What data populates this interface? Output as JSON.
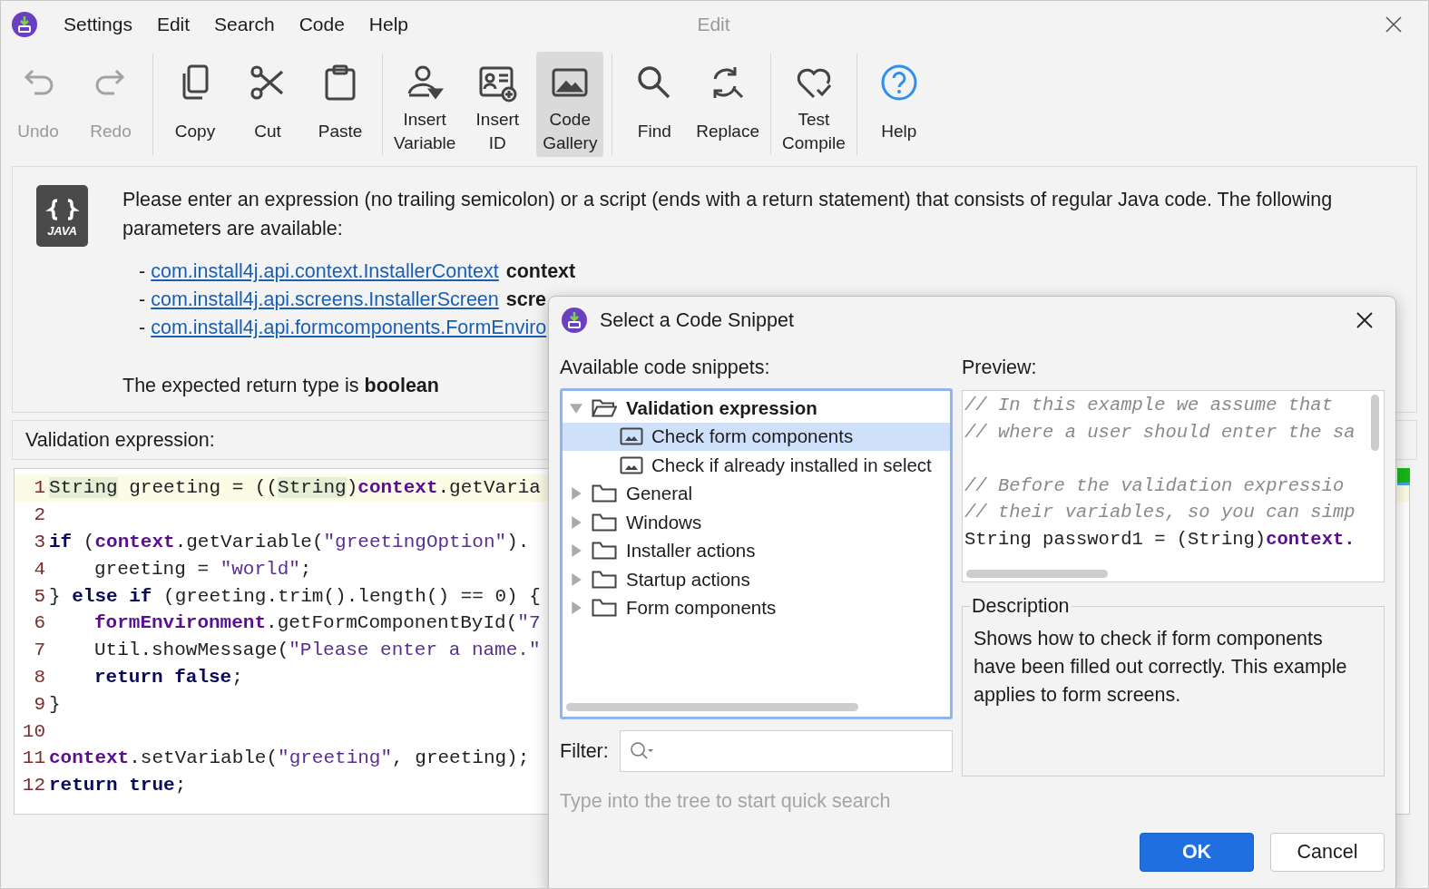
{
  "window": {
    "title": "Edit"
  },
  "menu": [
    "Settings",
    "Edit",
    "Search",
    "Code",
    "Help"
  ],
  "toolbar": [
    [
      {
        "label": "Undo",
        "disabled": true,
        "selected": false
      },
      {
        "label": "Redo",
        "disabled": true,
        "selected": false
      }
    ],
    [
      {
        "label": "Copy",
        "disabled": false,
        "selected": false
      },
      {
        "label": "Cut",
        "disabled": false,
        "selected": false
      },
      {
        "label": "Paste",
        "disabled": false,
        "selected": false
      }
    ],
    [
      {
        "label": "Insert Variable",
        "disabled": false,
        "selected": false
      },
      {
        "label": "Insert ID",
        "disabled": false,
        "selected": false
      },
      {
        "label": "Code Gallery",
        "disabled": false,
        "selected": true
      }
    ],
    [
      {
        "label": "Find",
        "disabled": false,
        "selected": false
      },
      {
        "label": "Replace",
        "disabled": false,
        "selected": false
      }
    ],
    [
      {
        "label": "Test Compile",
        "disabled": false,
        "selected": false
      }
    ],
    [
      {
        "label": "Help",
        "disabled": false,
        "selected": false
      }
    ]
  ],
  "info": {
    "badge": "JAVA",
    "text": "Please enter an expression (no trailing semicolon) or a script (ends with a return statement) that consists of regular Java code. The following parameters are available:",
    "parameters": [
      {
        "dash": "-",
        "type": "com.install4j.api.context.InstallerContext",
        "name": "context"
      },
      {
        "dash": "-",
        "type": "com.install4j.api.screens.InstallerScreen",
        "name": "scre"
      },
      {
        "dash": "-",
        "type": "com.install4j.api.formcomponents.FormEnviro"
      }
    ],
    "return_line": "The expected return type is **boolean**"
  },
  "editor": {
    "label": "Validation expression:",
    "lines": [
      {
        "number": "1",
        "current": true,
        "indented": false,
        "tokens": [
          {
            "kind": "type",
            "text": "String"
          },
          {
            "kind": "plain",
            "text": " greeting = (("
          },
          {
            "kind": "type",
            "text": "String"
          },
          {
            "kind": "plain",
            "text": ")"
          },
          {
            "kind": "field",
            "text": "context"
          },
          {
            "kind": "plain",
            "text": ".getVaria"
          }
        ]
      },
      {
        "number": "2",
        "current": false
      },
      {
        "number": "3",
        "current": false,
        "indented": false,
        "tokens": [
          {
            "kind": "keyword",
            "text": "if"
          },
          {
            "kind": "plain",
            "text": " ("
          },
          {
            "kind": "field",
            "text": "context"
          },
          {
            "kind": "plain",
            "text": ".getVariable("
          },
          {
            "kind": "string",
            "text": "\"greetingOption\""
          },
          {
            "kind": "plain",
            "text": ")."
          }
        ]
      },
      {
        "number": "4",
        "current": false,
        "indented": true,
        "tokens": [
          {
            "kind": "plain",
            "text": "greeting = "
          },
          {
            "kind": "string",
            "text": "\"world\""
          },
          {
            "kind": "plain",
            "text": ";"
          }
        ]
      },
      {
        "number": "5",
        "current": false,
        "indented": false,
        "tokens": [
          {
            "kind": "plain",
            "text": "} "
          },
          {
            "kind": "keyword",
            "text": "else if"
          },
          {
            "kind": "plain",
            "text": " (greeting.trim().length() == 0) {"
          }
        ]
      },
      {
        "number": "6",
        "current": false,
        "indented": true,
        "tokens": [
          {
            "kind": "field",
            "text": "formEnvironment"
          },
          {
            "kind": "plain",
            "text": ".getFormComponentById("
          },
          {
            "kind": "string",
            "text": "\"7"
          }
        ]
      },
      {
        "number": "7",
        "current": false,
        "indented": true,
        "tokens": [
          {
            "kind": "plain",
            "text": "Util.showMessage("
          },
          {
            "kind": "string",
            "text": "\"Please enter a name.\""
          }
        ]
      },
      {
        "number": "8",
        "current": false,
        "indented": true,
        "tokens": [
          {
            "kind": "keyword",
            "text": "return false"
          },
          {
            "kind": "plain",
            "text": ";"
          }
        ]
      },
      {
        "number": "9",
        "current": false,
        "indented": false,
        "tokens": [
          {
            "kind": "plain",
            "text": "}"
          }
        ]
      },
      {
        "number": "10",
        "current": false
      },
      {
        "number": "11",
        "current": false,
        "indented": false,
        "tokens": [
          {
            "kind": "field",
            "text": "context"
          },
          {
            "kind": "plain",
            "text": ".setVariable("
          },
          {
            "kind": "string",
            "text": "\"greeting\""
          },
          {
            "kind": "plain",
            "text": ", greeting);"
          }
        ]
      },
      {
        "number": "12",
        "current": false,
        "indented": false,
        "tokens": [
          {
            "kind": "keyword",
            "text": "return true"
          },
          {
            "kind": "plain",
            "text": ";"
          }
        ]
      }
    ]
  },
  "dialog": {
    "title": "Select a Code Snippet",
    "snippets_label": "Available code snippets:",
    "tree": [
      {
        "kind": "folder",
        "label": "Validation expression",
        "expanded": true,
        "selected": false,
        "children": [
          {
            "kind": "snippet",
            "label": "Check form components",
            "selected": true
          },
          {
            "kind": "snippet",
            "label": "Check if already installed in select",
            "selected": false
          }
        ]
      },
      {
        "kind": "folder",
        "label": "General",
        "expanded": false,
        "selected": false
      },
      {
        "kind": "folder",
        "label": "Windows",
        "expanded": false,
        "selected": false
      },
      {
        "kind": "folder",
        "label": "Installer actions",
        "expanded": false,
        "selected": false
      },
      {
        "kind": "folder",
        "label": "Startup actions",
        "expanded": false,
        "selected": false
      },
      {
        "kind": "folder",
        "label": "Form components",
        "expanded": false,
        "selected": false
      }
    ],
    "filter_label": "Filter:",
    "hint": "Type into the tree to start quick search",
    "preview_label": "Preview:",
    "preview": [
      {
        "kind": "code",
        "tokens": [
          {
            "kind": "comment",
            "text": "// In this example we assume that"
          }
        ]
      },
      {
        "kind": "code",
        "tokens": [
          {
            "kind": "comment",
            "text": "// where a user should enter the sa"
          }
        ]
      },
      {
        "kind": "blank"
      },
      {
        "kind": "code",
        "tokens": [
          {
            "kind": "comment",
            "text": "// Before the validation expressio"
          }
        ]
      },
      {
        "kind": "code",
        "tokens": [
          {
            "kind": "comment",
            "text": "// their variables, so you can simp"
          }
        ]
      },
      {
        "kind": "code",
        "tokens": [
          {
            "kind": "plain",
            "text": "String password1 = (String)"
          },
          {
            "kind": "field",
            "text": "context."
          }
        ]
      }
    ],
    "description_label": "Description",
    "description": "Shows how to check if form components have been filled out correctly. This example applies to form screens.",
    "buttons": [
      {
        "label": "OK",
        "kind": "primary"
      },
      {
        "label": "Cancel",
        "kind": "secondary"
      }
    ]
  }
}
